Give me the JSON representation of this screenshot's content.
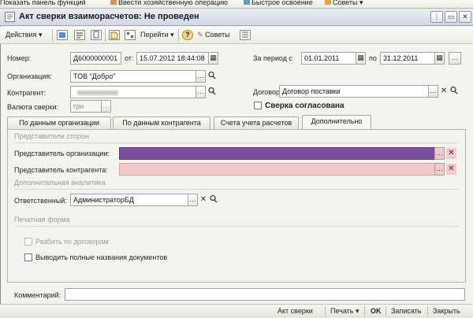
{
  "top_panel": {
    "items": [
      {
        "label": "Показать панель функций",
        "icon": "panel-icon"
      },
      {
        "label": "Ввести хозяйственную операцию",
        "icon": "operation-icon"
      },
      {
        "label": "Быстрое освоение",
        "icon": "learning-icon"
      },
      {
        "label": "Советы",
        "icon": "tips-icon"
      }
    ]
  },
  "window": {
    "title": "Акт сверки взаиморасчетов: Не проведен"
  },
  "toolbar": {
    "actions_label": "Действия",
    "goto_label": "Перейти",
    "tips_label": "Советы"
  },
  "form": {
    "number_label": "Номер:",
    "number_value": "Д6000000001",
    "from_label": "от:",
    "date_value": "15.07.2012 18:44:08",
    "period_label": "За период с",
    "period_from": "01.01.2011",
    "period_to_label": "по",
    "period_to": "31.12.2011",
    "organization_label": "Организация:",
    "organization_value": "ТОВ \"Добро\"",
    "counterparty_label": "Контрагент:",
    "counterparty_value": "",
    "contract_label": "Договор:",
    "contract_value": "Договор поставки",
    "currency_label": "Валюта сверки:",
    "currency_value": "грн",
    "agreed_label": "Сверка согласована"
  },
  "tabs": [
    {
      "label": "По данным организации",
      "active": false
    },
    {
      "label": "По данным контрагента",
      "active": false
    },
    {
      "label": "Счета учета расчетов",
      "active": false
    },
    {
      "label": "Дополнительно",
      "active": true
    }
  ],
  "additional": {
    "representatives_section": "Представители сторон",
    "org_rep_label": "Представитель организации:",
    "org_rep_value": "",
    "cp_rep_label": "Представитель контрагента:",
    "cp_rep_value": "",
    "analytics_section": "Дополнительная аналитика",
    "responsible_label": "Ответственный:",
    "responsible_value": "АдминистраторБД",
    "print_section": "Печатная форма",
    "split_by_contracts_label": "Разбить по договорам",
    "full_names_label": "Выводить полные названия документов"
  },
  "comment": {
    "label": "Комментарий:",
    "value": ""
  },
  "footer": {
    "act_label": "Акт сверки",
    "print_label": "Печать",
    "ok_label": "OK",
    "save_label": "Записать",
    "close_label": "Закрыть"
  },
  "colors": {
    "org_rep_fill": "#7b4f9c",
    "required_fill": "#f3c9c9",
    "title_gradient": "#cfd9e4"
  }
}
